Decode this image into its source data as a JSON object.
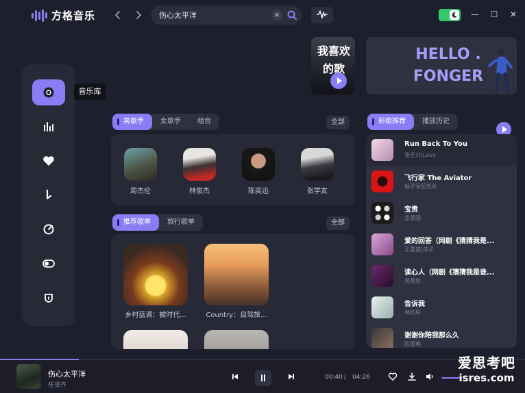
{
  "app": {
    "name": "方格音乐",
    "accent": "#8b7cf6",
    "background": "#1e1f2c"
  },
  "titlebar": {
    "back_icon": "chevron-left-icon",
    "forward_icon": "chevron-right-icon",
    "search_value": "伤心太平洋",
    "clear_icon": "close-icon",
    "search_icon": "search-icon",
    "wave_icon": "waveform-icon",
    "theme_icon": "moon-icon",
    "minimize": "—",
    "maximize": "☐",
    "close": "✕"
  },
  "banners": {
    "album_text": "我喜欢的歌",
    "hello_line1": "HELLO .",
    "hello_line2": "FONGER"
  },
  "sidebar": {
    "items": [
      {
        "icon": "disc-icon",
        "active": true
      },
      {
        "icon": "bar-chart-icon",
        "active": false
      },
      {
        "icon": "heart-icon",
        "active": false
      },
      {
        "icon": "music-note-icon",
        "active": false
      },
      {
        "icon": "target-icon",
        "active": false
      },
      {
        "icon": "toggle-icon",
        "active": false
      },
      {
        "icon": "shield-icon",
        "active": false
      }
    ],
    "tooltip": "音乐库"
  },
  "singers": {
    "tabs": [
      "男歌手",
      "女歌手",
      "组合"
    ],
    "active_tab": 0,
    "all_label": "全部",
    "list": [
      {
        "name": "周杰伦"
      },
      {
        "name": "林俊杰"
      },
      {
        "name": "陈奕迅"
      },
      {
        "name": "张学友"
      }
    ]
  },
  "playlists": {
    "tabs": [
      "推荐歌单",
      "旅行歌单"
    ],
    "active_tab": 0,
    "all_label": "全部",
    "list": [
      {
        "title": "乡村蓝调：被时代..."
      },
      {
        "title": "Country：自驾旅..."
      }
    ]
  },
  "songs": {
    "tabs": [
      "新歌推荐",
      "播放历史"
    ],
    "active_tab": 0,
    "list": [
      {
        "title": "Run Back To You",
        "artist": "张艺兴|Lauv"
      },
      {
        "title": "飞行家 The Aviator",
        "artist": "猴子军团乐队"
      },
      {
        "title": "宝贵",
        "artist": "孟慧圆"
      },
      {
        "title": "爱的回答（网剧《猜猜我是...",
        "artist": "王嘉诚|孩子"
      },
      {
        "title": "读心人（网剧《猜猜我是谁...",
        "artist": "吴莫愁"
      },
      {
        "title": "告诉我",
        "artist": "林欣彤"
      },
      {
        "title": "谢谢你陪我那么久",
        "artist": "陈慧琳"
      }
    ]
  },
  "player": {
    "title": "伤心太平洋",
    "artist": "任贤齐",
    "current_time": "00:40",
    "separator": "/",
    "total_time": "04:26",
    "progress": 0.15
  },
  "watermark": {
    "cn": "爱思考吧",
    "en": "isres.com"
  }
}
